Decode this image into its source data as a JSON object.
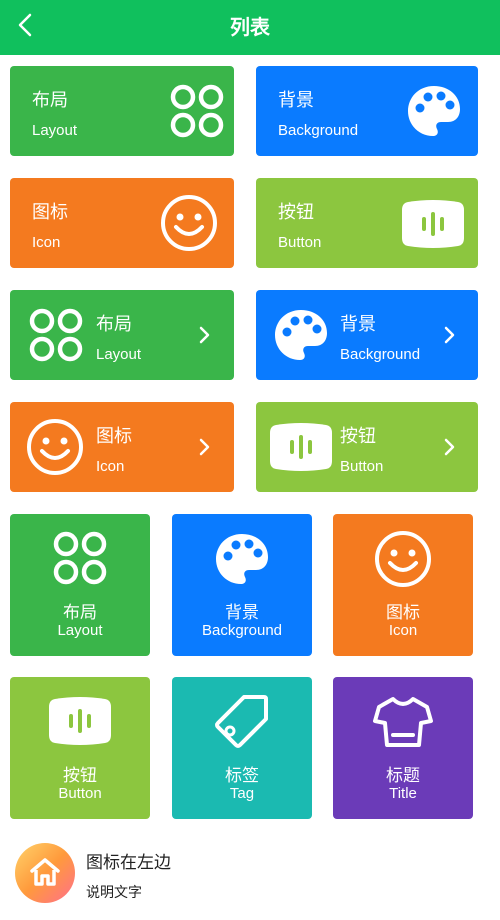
{
  "header": {
    "title": "列表"
  },
  "row_cards": [
    {
      "title": "布局",
      "subtitle": "Layout",
      "icon": "grid-circles-icon",
      "color": "#3ab54a"
    },
    {
      "title": "背景",
      "subtitle": "Background",
      "icon": "palette-icon",
      "color": "#0a7bff"
    },
    {
      "title": "图标",
      "subtitle": "Icon",
      "icon": "smiley-icon",
      "color": "#f47a1f"
    },
    {
      "title": "按钮",
      "subtitle": "Button",
      "icon": "button-icon",
      "color": "#8cc63f"
    }
  ],
  "icon_left_cards": [
    {
      "title": "布局",
      "subtitle": "Layout",
      "icon": "grid-circles-icon"
    },
    {
      "title": "背景",
      "subtitle": "Background",
      "icon": "palette-icon"
    },
    {
      "title": "图标",
      "subtitle": "Icon",
      "icon": "smiley-icon"
    },
    {
      "title": "按钮",
      "subtitle": "Button",
      "icon": "button-icon"
    }
  ],
  "tiles": [
    {
      "title": "布局",
      "subtitle": "Layout",
      "icon": "grid-circles-icon",
      "color": "#3ab54a"
    },
    {
      "title": "背景",
      "subtitle": "Background",
      "icon": "palette-icon",
      "color": "#0a7bff"
    },
    {
      "title": "图标",
      "subtitle": "Icon",
      "icon": "smiley-icon",
      "color": "#f47a1f"
    },
    {
      "title": "按钮",
      "subtitle": "Button",
      "icon": "button-icon",
      "color": "#8cc63f"
    },
    {
      "title": "标签",
      "subtitle": "Tag",
      "icon": "tag-icon",
      "color": "#1bbab1"
    },
    {
      "title": "标题",
      "subtitle": "Title",
      "icon": "tshirt-icon",
      "color": "#6b3bb8"
    }
  ],
  "bottom_item": {
    "title": "图标在左边",
    "desc": "说明文字",
    "icon": "home-icon"
  }
}
